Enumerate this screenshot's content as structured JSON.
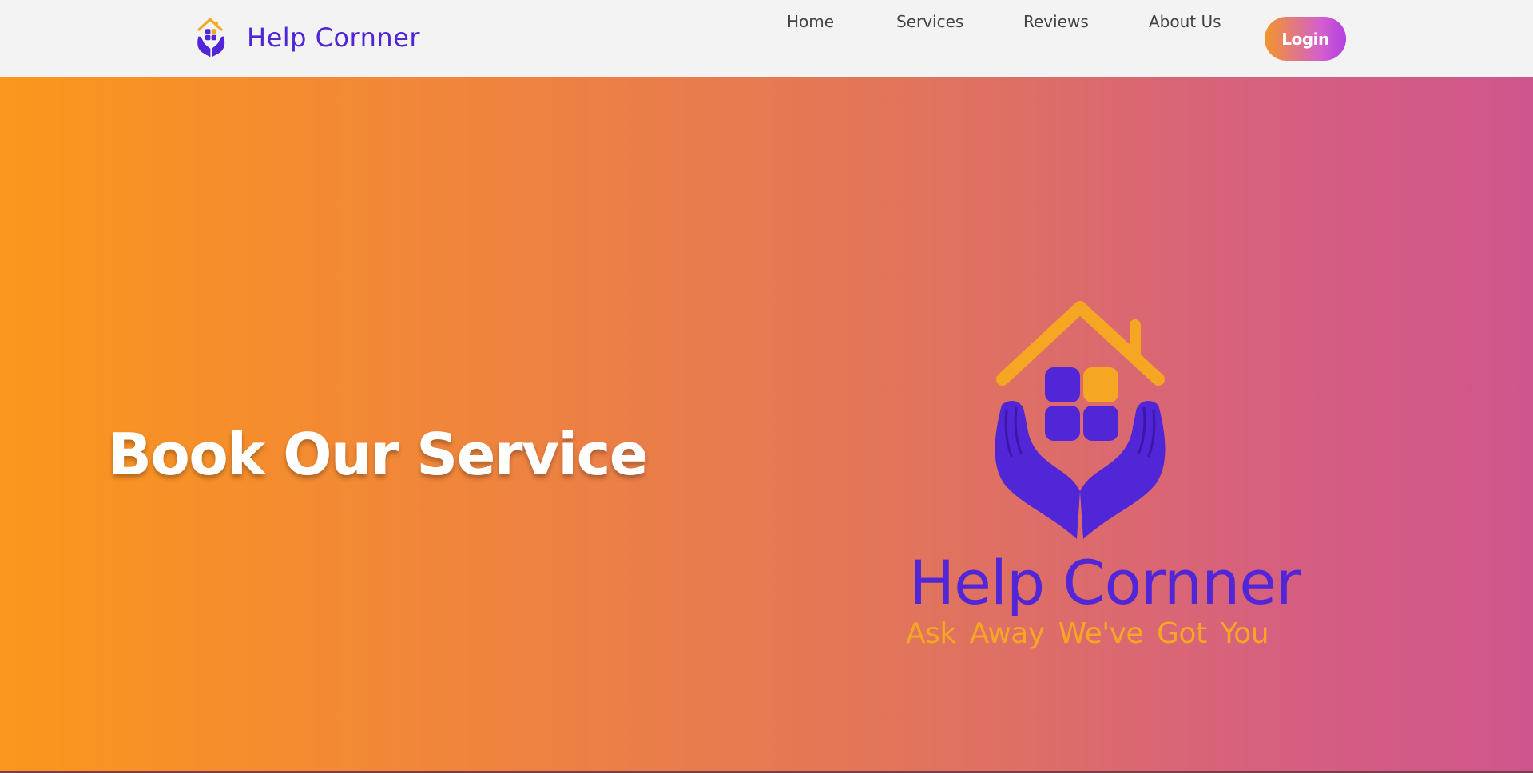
{
  "header": {
    "brand_name": "Help Cornner",
    "brand_icon": "house-hands-icon",
    "nav": [
      {
        "label": "Home"
      },
      {
        "label": "Services"
      },
      {
        "label": "Reviews"
      },
      {
        "label": "About Us"
      }
    ],
    "login_label": "Login"
  },
  "hero": {
    "title": "Book Our Service",
    "logo": {
      "icon": "house-hands-icon",
      "name": "Help Cornner",
      "tagline": "Ask Away  We've Got You"
    }
  },
  "colors": {
    "brand_purple": "#5126d6",
    "brand_orange": "#f5a623",
    "hero_gradient_start": "#fb971c",
    "hero_gradient_end": "#cf568c",
    "login_gradient_start": "#f2962a",
    "login_gradient_end": "#b340e0"
  }
}
